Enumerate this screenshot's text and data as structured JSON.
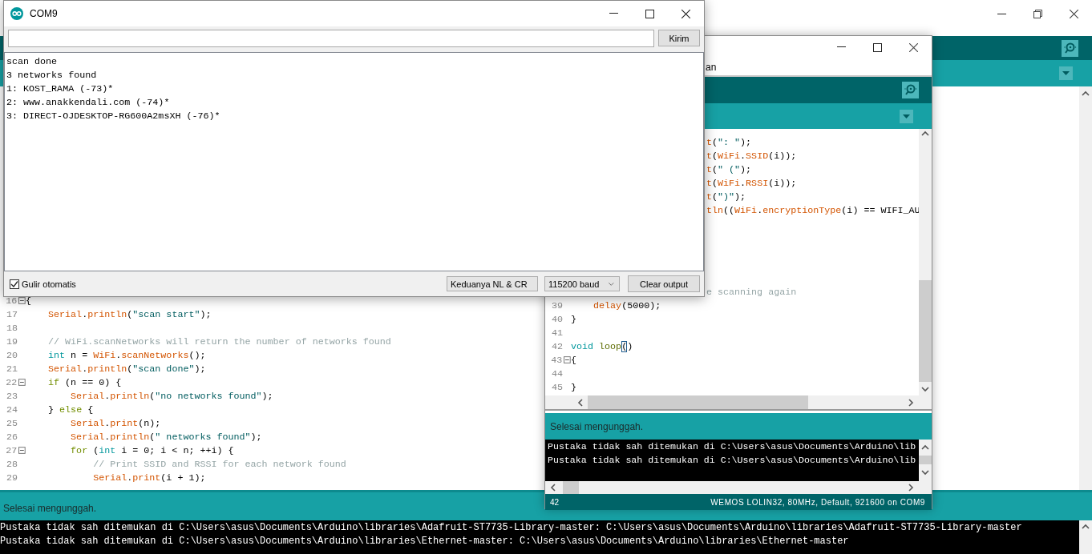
{
  "serial_monitor": {
    "title": "COM9",
    "send_button": "Kirim",
    "output": [
      "scan done",
      "3 networks found",
      "1: KOST_RAMA (-73)*",
      "2: www.anakkendali.com (-74)*",
      "3: DIRECT-OJDESKTOP-RG600A2msXH (-76)*"
    ],
    "autoscroll": {
      "label": "Gulir otomatis",
      "checked": true
    },
    "line_ending": "Keduanya NL & CR",
    "baud": "115200 baud",
    "clear_button": "Clear output"
  },
  "second_window": {
    "menu_text": "an",
    "editor_lines": [
      {
        "kind": "clipped",
        "tokens": [
          {
            "kind": "fn",
            "text": "t"
          },
          {
            "kind": "plain",
            "text": "("
          },
          {
            "kind": "str",
            "text": "\": \""
          },
          {
            "kind": "plain",
            "text": ");"
          }
        ]
      },
      {
        "kind": "clipped",
        "tokens": [
          {
            "kind": "fn",
            "text": "t"
          },
          {
            "kind": "plain",
            "text": "("
          },
          {
            "kind": "fn",
            "text": "WiFi"
          },
          {
            "kind": "plain",
            "text": "."
          },
          {
            "kind": "fn",
            "text": "SSID"
          },
          {
            "kind": "plain",
            "text": "(i));"
          }
        ]
      },
      {
        "kind": "clipped",
        "tokens": [
          {
            "kind": "fn",
            "text": "t"
          },
          {
            "kind": "plain",
            "text": "("
          },
          {
            "kind": "str",
            "text": "\" (\""
          },
          {
            "kind": "plain",
            "text": ");"
          }
        ]
      },
      {
        "kind": "clipped",
        "tokens": [
          {
            "kind": "fn",
            "text": "t"
          },
          {
            "kind": "plain",
            "text": "("
          },
          {
            "kind": "fn",
            "text": "WiFi"
          },
          {
            "kind": "plain",
            "text": "."
          },
          {
            "kind": "fn",
            "text": "RSSI"
          },
          {
            "kind": "plain",
            "text": "(i));"
          }
        ]
      },
      {
        "kind": "clipped",
        "tokens": [
          {
            "kind": "fn",
            "text": "t"
          },
          {
            "kind": "plain",
            "text": "("
          },
          {
            "kind": "str",
            "text": "\")\""
          },
          {
            "kind": "plain",
            "text": ");"
          }
        ]
      },
      {
        "kind": "clipped",
        "tokens": [
          {
            "kind": "fn",
            "text": "tln"
          },
          {
            "kind": "plain",
            "text": "(("
          },
          {
            "kind": "fn",
            "text": "WiFi"
          },
          {
            "kind": "plain",
            "text": "."
          },
          {
            "kind": "fn",
            "text": "encryptionType"
          },
          {
            "kind": "plain",
            "text": "(i) == WIFI_AU"
          }
        ]
      },
      {
        "kind": "blank"
      },
      {
        "kind": "blank"
      },
      {
        "kind": "blank"
      },
      {
        "kind": "blank"
      },
      {
        "kind": "blank"
      },
      {
        "kind": "clipped",
        "tokens": [
          {
            "kind": "cmt",
            "text": "e scanning again"
          }
        ]
      },
      {
        "kind": "numbered",
        "number": "39",
        "tokens": [
          {
            "kind": "fn",
            "text": "    delay"
          },
          {
            "kind": "plain",
            "text": "(5000);"
          }
        ]
      },
      {
        "kind": "numbered",
        "number": "40",
        "tokens": [
          {
            "kind": "plain",
            "text": "}"
          }
        ]
      },
      {
        "kind": "numbered",
        "number": "41"
      },
      {
        "kind": "numbered",
        "number": "42",
        "tokens": [
          {
            "kind": "type",
            "text": "void"
          },
          {
            "kind": "call",
            "text": " loop"
          },
          {
            "kind": "match",
            "text": "("
          },
          {
            "kind": "plain",
            "text": ")"
          }
        ]
      },
      {
        "kind": "numbered",
        "number": "43",
        "fold": true,
        "tokens": [
          {
            "kind": "plain",
            "text": "{"
          }
        ]
      },
      {
        "kind": "numbered",
        "number": "44"
      },
      {
        "kind": "numbered",
        "number": "45",
        "tokens": [
          {
            "kind": "plain",
            "text": "}"
          }
        ]
      }
    ],
    "status": "Selesai mengunggah.",
    "console": [
      "Pustaka tidak sah ditemukan di C:\\Users\\asus\\Documents\\Arduino\\lib",
      "Pustaka tidak sah ditemukan di C:\\Users\\asus\\Documents\\Arduino\\lib"
    ],
    "line_number": "42",
    "board": "WEMOS LOLIN32, 80MHz, Default, 921600 on COM9"
  },
  "background_window": {
    "editor_lines": [
      {
        "kind": "numbered",
        "number": "16",
        "fold": true,
        "tokens": [
          {
            "kind": "plain",
            "text": "{"
          }
        ]
      },
      {
        "kind": "numbered",
        "number": "17",
        "tokens": [
          {
            "kind": "fn",
            "text": "    Serial"
          },
          {
            "kind": "plain",
            "text": "."
          },
          {
            "kind": "fn",
            "text": "println"
          },
          {
            "kind": "plain",
            "text": "("
          },
          {
            "kind": "str",
            "text": "\"scan start\""
          },
          {
            "kind": "plain",
            "text": ");"
          }
        ]
      },
      {
        "kind": "numbered",
        "number": "18"
      },
      {
        "kind": "numbered",
        "number": "19",
        "tokens": [
          {
            "kind": "cmt",
            "text": "    // WiFi.scanNetworks will return the number of networks found"
          }
        ]
      },
      {
        "kind": "numbered",
        "number": "20",
        "tokens": [
          {
            "kind": "type",
            "text": "    int"
          },
          {
            "kind": "plain",
            "text": " n = "
          },
          {
            "kind": "fn",
            "text": "WiFi"
          },
          {
            "kind": "plain",
            "text": "."
          },
          {
            "kind": "fn",
            "text": "scanNetworks"
          },
          {
            "kind": "plain",
            "text": "();"
          }
        ]
      },
      {
        "kind": "numbered",
        "number": "21",
        "tokens": [
          {
            "kind": "fn",
            "text": "    Serial"
          },
          {
            "kind": "plain",
            "text": "."
          },
          {
            "kind": "fn",
            "text": "println"
          },
          {
            "kind": "plain",
            "text": "("
          },
          {
            "kind": "str",
            "text": "\"scan done\""
          },
          {
            "kind": "plain",
            "text": ");"
          }
        ]
      },
      {
        "kind": "numbered",
        "number": "22",
        "fold": true,
        "tokens": [
          {
            "kind": "kw",
            "text": "    if"
          },
          {
            "kind": "plain",
            "text": " (n == 0) {"
          }
        ]
      },
      {
        "kind": "numbered",
        "number": "23",
        "tokens": [
          {
            "kind": "fn",
            "text": "        Serial"
          },
          {
            "kind": "plain",
            "text": "."
          },
          {
            "kind": "fn",
            "text": "println"
          },
          {
            "kind": "plain",
            "text": "("
          },
          {
            "kind": "str",
            "text": "\"no networks found\""
          },
          {
            "kind": "plain",
            "text": ");"
          }
        ]
      },
      {
        "kind": "numbered",
        "number": "24",
        "tokens": [
          {
            "kind": "plain",
            "text": "    } "
          },
          {
            "kind": "kw",
            "text": "else"
          },
          {
            "kind": "plain",
            "text": " {"
          }
        ]
      },
      {
        "kind": "numbered",
        "number": "25",
        "tokens": [
          {
            "kind": "fn",
            "text": "        Serial"
          },
          {
            "kind": "plain",
            "text": "."
          },
          {
            "kind": "fn",
            "text": "print"
          },
          {
            "kind": "plain",
            "text": "(n);"
          }
        ]
      },
      {
        "kind": "numbered",
        "number": "26",
        "tokens": [
          {
            "kind": "fn",
            "text": "        Serial"
          },
          {
            "kind": "plain",
            "text": "."
          },
          {
            "kind": "fn",
            "text": "println"
          },
          {
            "kind": "plain",
            "text": "("
          },
          {
            "kind": "str",
            "text": "\" networks found\""
          },
          {
            "kind": "plain",
            "text": ");"
          }
        ]
      },
      {
        "kind": "numbered",
        "number": "27",
        "fold": true,
        "tokens": [
          {
            "kind": "kw",
            "text": "        for"
          },
          {
            "kind": "plain",
            "text": " ("
          },
          {
            "kind": "type",
            "text": "int"
          },
          {
            "kind": "plain",
            "text": " i = 0; i < n; ++i) {"
          }
        ]
      },
      {
        "kind": "numbered",
        "number": "28",
        "tokens": [
          {
            "kind": "cmt",
            "text": "            // Print SSID and RSSI for each network found"
          }
        ]
      },
      {
        "kind": "numbered",
        "number": "29",
        "tokens": [
          {
            "kind": "fn",
            "text": "            Serial"
          },
          {
            "kind": "plain",
            "text": "."
          },
          {
            "kind": "fn",
            "text": "print"
          },
          {
            "kind": "plain",
            "text": "(i + 1);"
          }
        ]
      }
    ],
    "status": "Selesai mengunggah.",
    "console": [
      "Pustaka tidak sah ditemukan di C:\\Users\\asus\\Documents\\Arduino\\libraries\\Adafruit-ST7735-Library-master: C:\\Users\\asus\\Documents\\Arduino\\libraries\\Adafruit-ST7735-Library-master",
      "Pustaka tidak sah ditemukan di C:\\Users\\asus\\Documents\\Arduino\\libraries\\Ethernet-master: C:\\Users\\asus\\Documents\\Arduino\\libraries\\Ethernet-master"
    ]
  }
}
